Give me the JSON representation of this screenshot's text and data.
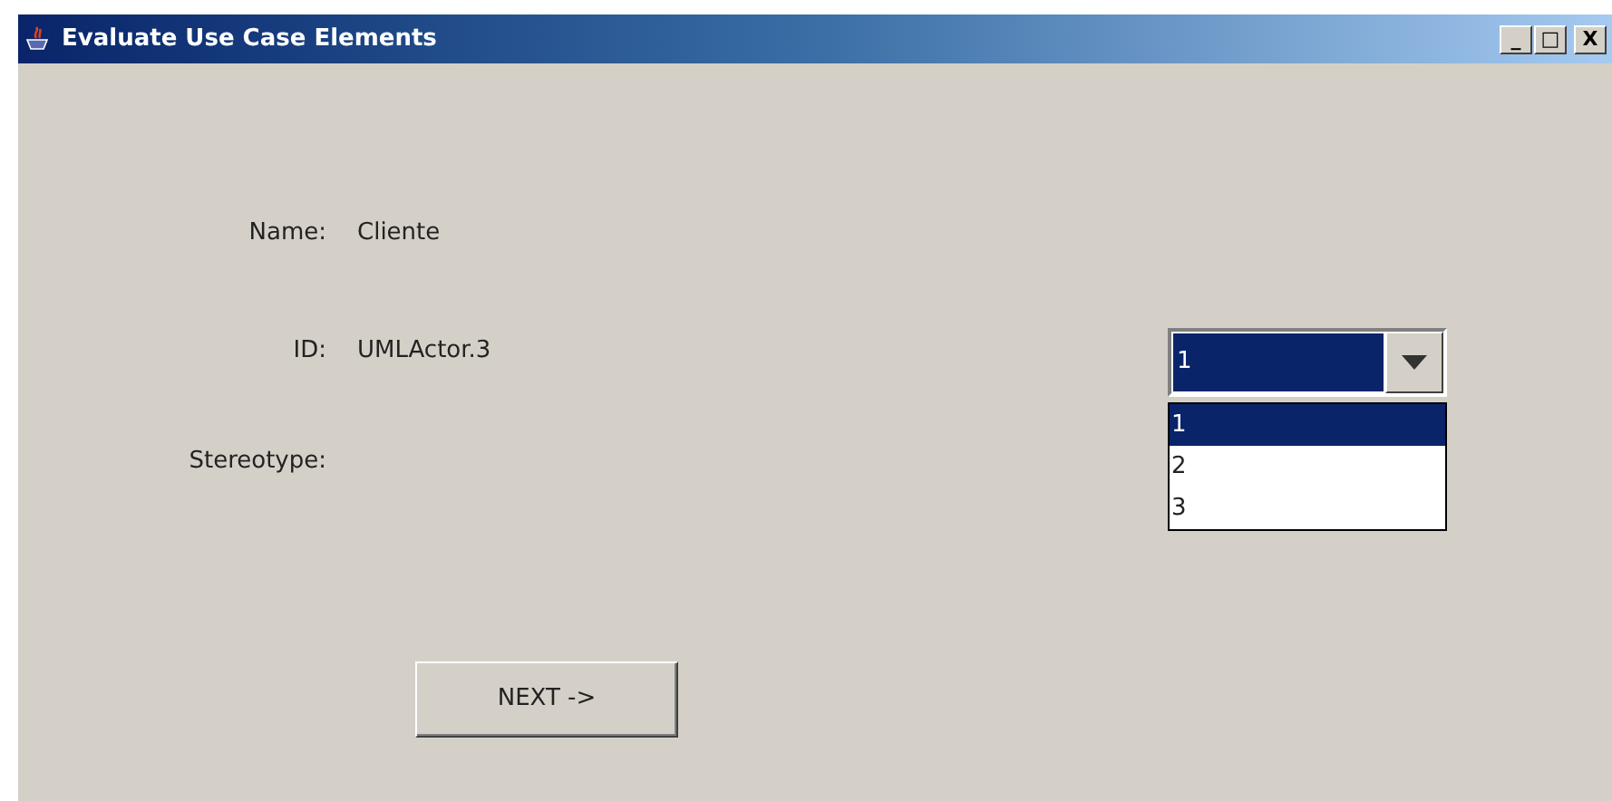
{
  "window": {
    "title": "Evaluate Use Case Elements",
    "controls": [
      "_",
      "□",
      "X"
    ]
  },
  "fields": [
    {
      "label": "Name:",
      "value": "Cliente"
    },
    {
      "label": "ID:",
      "value": "UMLActor.3"
    },
    {
      "label": "Stereotype:"
    }
  ],
  "combo": {
    "value": "1",
    "expanded": true,
    "options": [
      {
        "label": "1",
        "selected": true
      },
      {
        "label": "2",
        "selected": false
      },
      {
        "label": "3",
        "selected": false
      }
    ]
  },
  "next_button": "NEXT ->"
}
